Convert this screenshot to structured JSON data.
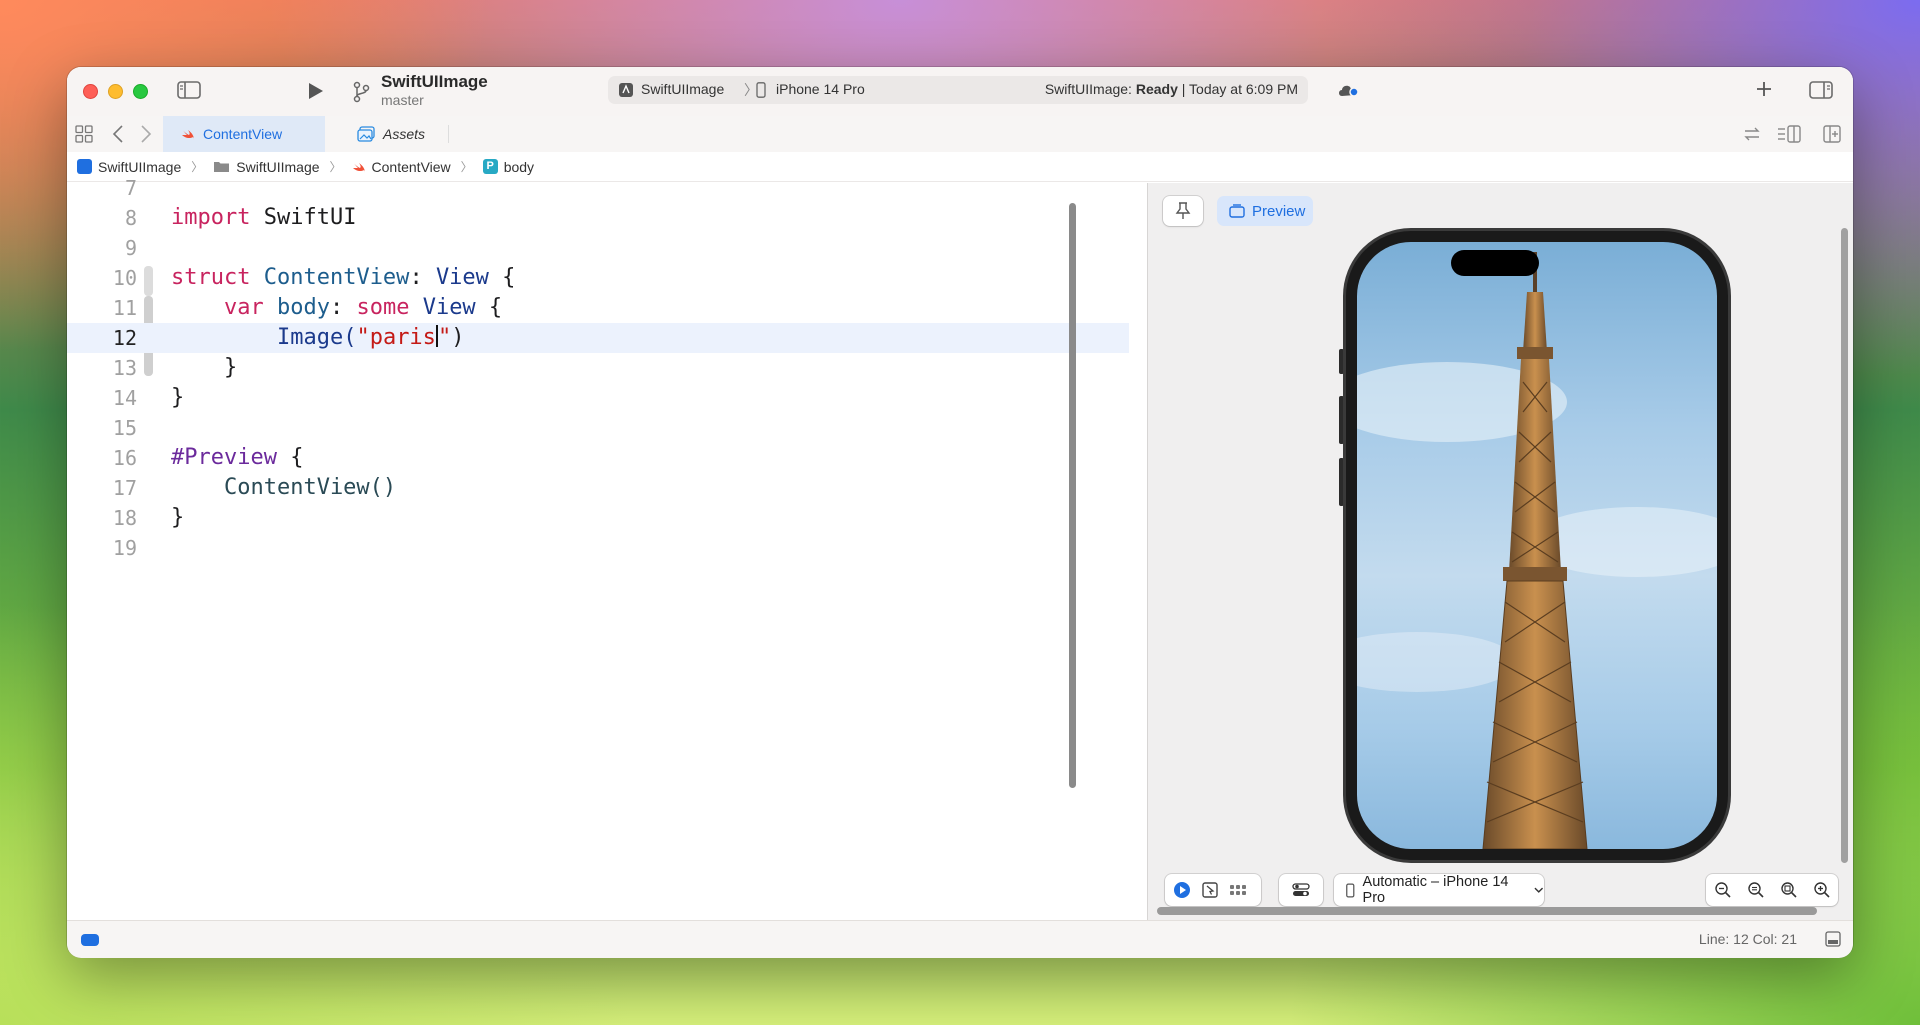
{
  "titlebar": {
    "project_name": "SwiftUIImage",
    "branch": "master",
    "scheme": {
      "target": "SwiftUIImage",
      "device": "iPhone 14 Pro",
      "status_prefix": "SwiftUIImage: ",
      "status_state": "Ready",
      "status_time": " | Today at 6:09 PM"
    }
  },
  "tabs": [
    {
      "label": "ContentView",
      "icon": "swift-file-icon",
      "active": true
    },
    {
      "label": "Assets",
      "icon": "assets-catalog-icon",
      "active": false
    }
  ],
  "breadcrumb": [
    "SwiftUIImage",
    "SwiftUIImage",
    "ContentView",
    "body"
  ],
  "breadcrumb_symbol_badge": "P",
  "editor": {
    "lines": [
      {
        "n": "7"
      },
      {
        "n": "8"
      },
      {
        "n": "9"
      },
      {
        "n": "10"
      },
      {
        "n": "11"
      },
      {
        "n": "12"
      },
      {
        "n": "13"
      },
      {
        "n": "14"
      },
      {
        "n": "15"
      },
      {
        "n": "16"
      },
      {
        "n": "17"
      },
      {
        "n": "18"
      },
      {
        "n": "19"
      }
    ],
    "tokens": {
      "import": "import",
      "swiftui": " SwiftUI",
      "struct": "struct",
      "contentview": " ContentView",
      "colon": ": ",
      "view": "View",
      "brace_open": " {",
      "indent1": "    ",
      "var": "var",
      "body": " body",
      "colon2": ": ",
      "some": "some",
      "view2": " View",
      "brace_open2": " {",
      "indent2": "        ",
      "image": "Image(",
      "str_open": "\"paris",
      "str_close": "\"",
      "paren_close": ")",
      "close_inner": "    }",
      "close_outer": "}",
      "preview": "#Preview",
      "brace_open3": " {",
      "contentview_call": "    ContentView()",
      "close_preview": "}"
    },
    "current_line": "12"
  },
  "canvas": {
    "preview_label": "Preview",
    "device_selector": "Automatic – iPhone 14 Pro"
  },
  "statusbar": {
    "line_col": "Line: 12  Col: 21"
  },
  "colors": {
    "accent": "#1f6fe0",
    "keyword": "#c8245f",
    "string": "#c41a16",
    "type": "#1b3a8c"
  }
}
